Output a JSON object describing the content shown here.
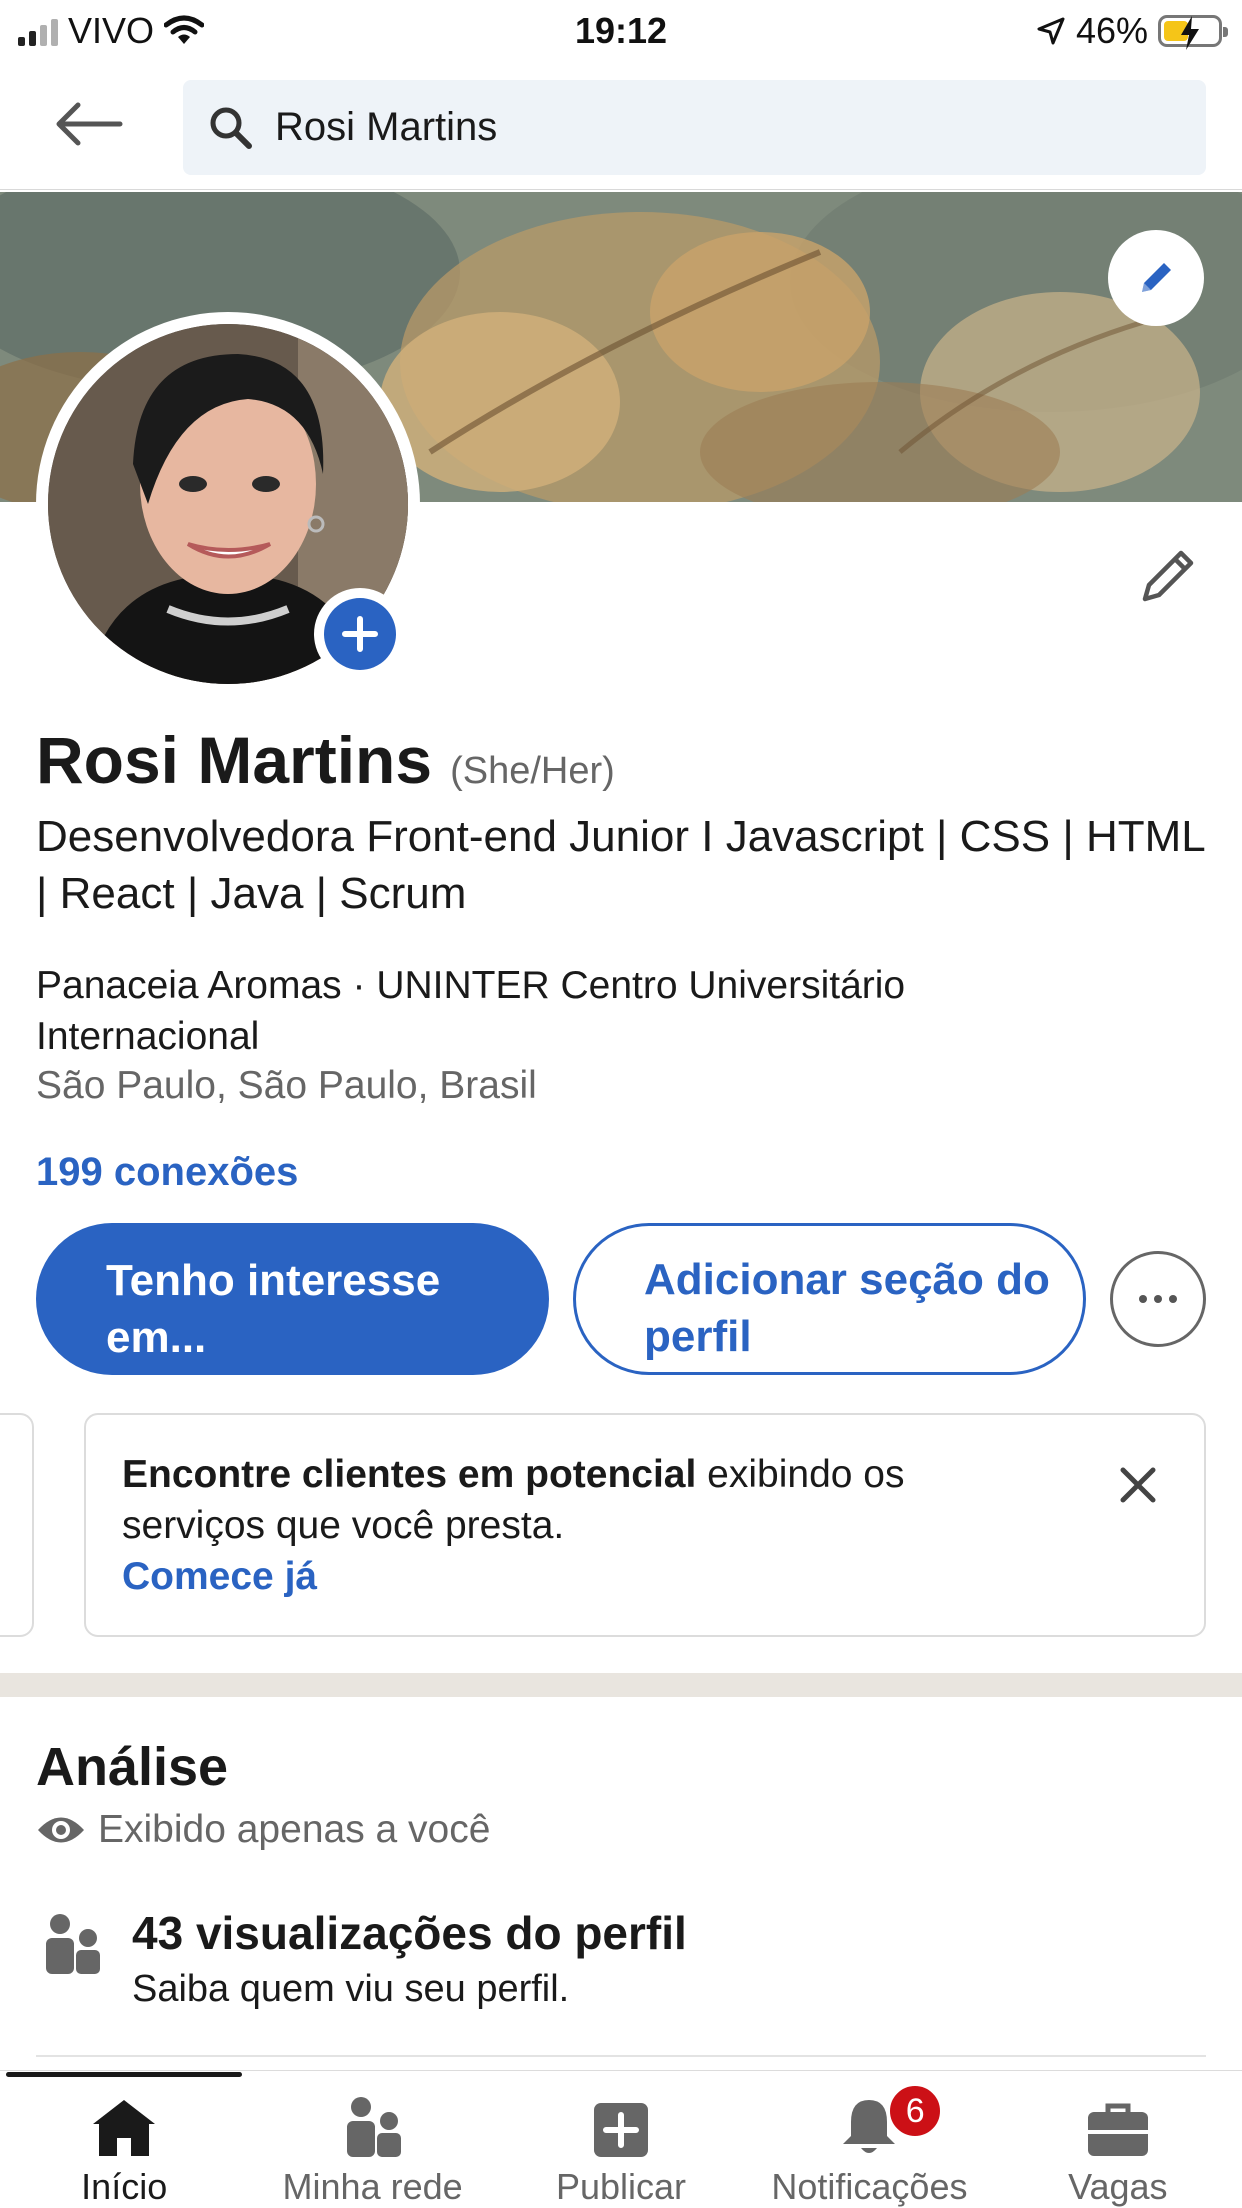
{
  "status_bar": {
    "carrier": "VIVO",
    "time": "19:12",
    "battery_percent": "46%",
    "battery_level": 0.46,
    "battery_color": "#f5c518",
    "icons": [
      "signal-icon",
      "wifi-icon",
      "location-arrow-icon",
      "battery-charging-icon"
    ]
  },
  "search": {
    "value": "Rosi Martins",
    "icons": [
      "back-arrow-icon",
      "search-icon"
    ]
  },
  "profile": {
    "name": "Rosi Martins",
    "pronouns": "(She/Her)",
    "headline": "Desenvolvedora Front-end Junior I  Javascript | CSS | HTML | React | Java | Scrum",
    "company": "Panaceia Aromas · UNINTER Centro Universitário Internacional",
    "location": "São Paulo, São Paulo, Brasil",
    "connections": "199 conexões"
  },
  "actions": {
    "primary_label": "Tenho interesse em...",
    "secondary_label": "Adicionar seção do perfil",
    "more_icon": "more-horizontal-icon"
  },
  "promo": {
    "bold_text": "Encontre clientes em potencial",
    "text": " exibindo os serviços que você presta.",
    "cta": "Comece já"
  },
  "analytics": {
    "title": "Análise",
    "visibility": "Exibido apenas a você",
    "profile_views_title": "43 visualizações do perfil",
    "profile_views_subtitle": "Saiba quem viu seu perfil."
  },
  "bottom_nav": {
    "items": [
      {
        "label": "Início",
        "icon": "home-icon",
        "active": true
      },
      {
        "label": "Minha rede",
        "icon": "my-network-icon"
      },
      {
        "label": "Publicar",
        "icon": "post-icon"
      },
      {
        "label": "Notificações",
        "icon": "bell-icon",
        "badge": "6"
      },
      {
        "label": "Vagas",
        "icon": "briefcase-icon"
      }
    ]
  },
  "colors": {
    "accent": "#2a63c2",
    "badge": "#cc1016",
    "text": "#1a1a1a",
    "muted": "#666666"
  }
}
